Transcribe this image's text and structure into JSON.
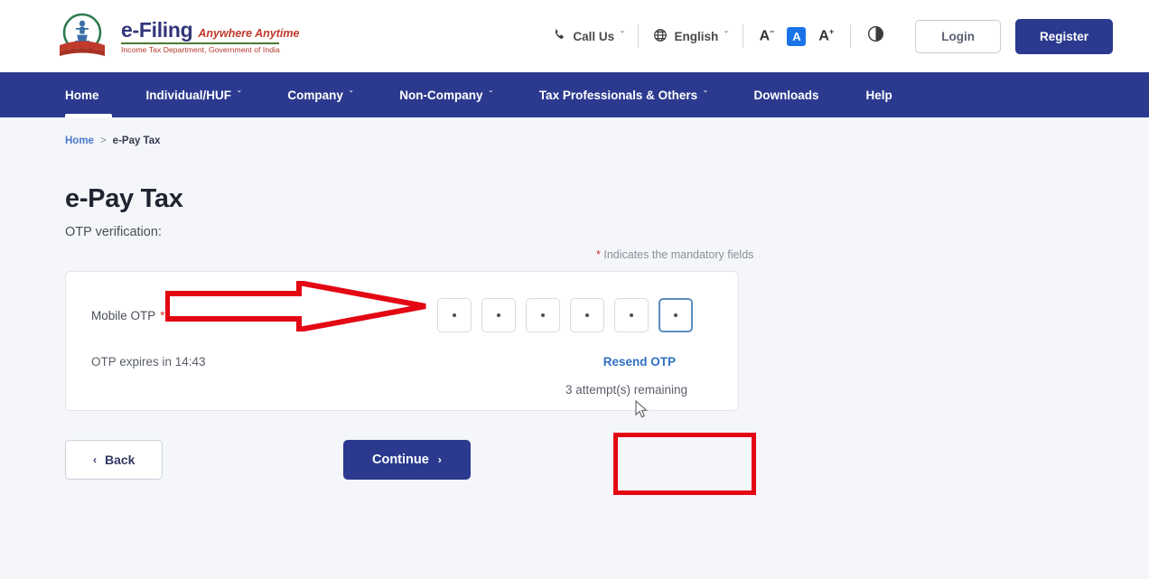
{
  "header": {
    "brand": {
      "name": "e-Filing",
      "tagline": "Anywhere Anytime",
      "subtitle": "Income Tax Department, Government of India",
      "emblem_icon": "india-emblem-icon"
    },
    "call_us": {
      "label": "Call Us",
      "icon": "phone-icon",
      "caret": "ˇ"
    },
    "language": {
      "label": "English",
      "icon": "globe-icon",
      "caret": "ˇ"
    },
    "font_controls": {
      "decrease": "A",
      "decrease_sup": "−",
      "normal": "A",
      "increase": "A",
      "increase_sup": "+"
    },
    "contrast_icon": "contrast-icon",
    "login_label": "Login",
    "register_label": "Register"
  },
  "nav": {
    "items": [
      {
        "label": "Home",
        "has_caret": false,
        "active": true
      },
      {
        "label": "Individual/HUF",
        "has_caret": true,
        "active": false
      },
      {
        "label": "Company",
        "has_caret": true,
        "active": false
      },
      {
        "label": "Non-Company",
        "has_caret": true,
        "active": false
      },
      {
        "label": "Tax Professionals & Others",
        "has_caret": true,
        "active": false
      },
      {
        "label": "Downloads",
        "has_caret": false,
        "active": false
      },
      {
        "label": "Help",
        "has_caret": false,
        "active": false
      }
    ],
    "caret": "ˇ"
  },
  "breadcrumb": {
    "home": "Home",
    "separator": ">",
    "current": "e-Pay Tax"
  },
  "page": {
    "title": "e-Pay Tax",
    "subtitle": "OTP verification:",
    "mandatory_note_ast": "*",
    "mandatory_note": " Indicates the mandatory fields"
  },
  "otp_form": {
    "label": "Mobile OTP",
    "required_mark": "*",
    "boxes": [
      {
        "value": "•",
        "focused": false
      },
      {
        "value": "•",
        "focused": false
      },
      {
        "value": "•",
        "focused": false
      },
      {
        "value": "•",
        "focused": false
      },
      {
        "value": "•",
        "focused": false
      },
      {
        "value": "•",
        "focused": true
      }
    ],
    "expires_text": "OTP expires in 14:43",
    "resend_label": "Resend OTP",
    "attempts_text": "3 attempt(s) remaining"
  },
  "actions": {
    "back_label": "Back",
    "back_chevron": "‹",
    "continue_label": "Continue",
    "continue_chevron": "›"
  },
  "annotations": {
    "arrow_color": "#e30613",
    "rect_color": "#e30613",
    "arrow_target": "otp-input-boxes",
    "rect_target": "continue-button"
  },
  "colors": {
    "brand_navy": "#2b3a8f",
    "page_bg": "#f4f6fa",
    "link_blue": "#2f6fc4",
    "required_red": "#d0342c",
    "focus_blue": "#5b8cc0"
  }
}
